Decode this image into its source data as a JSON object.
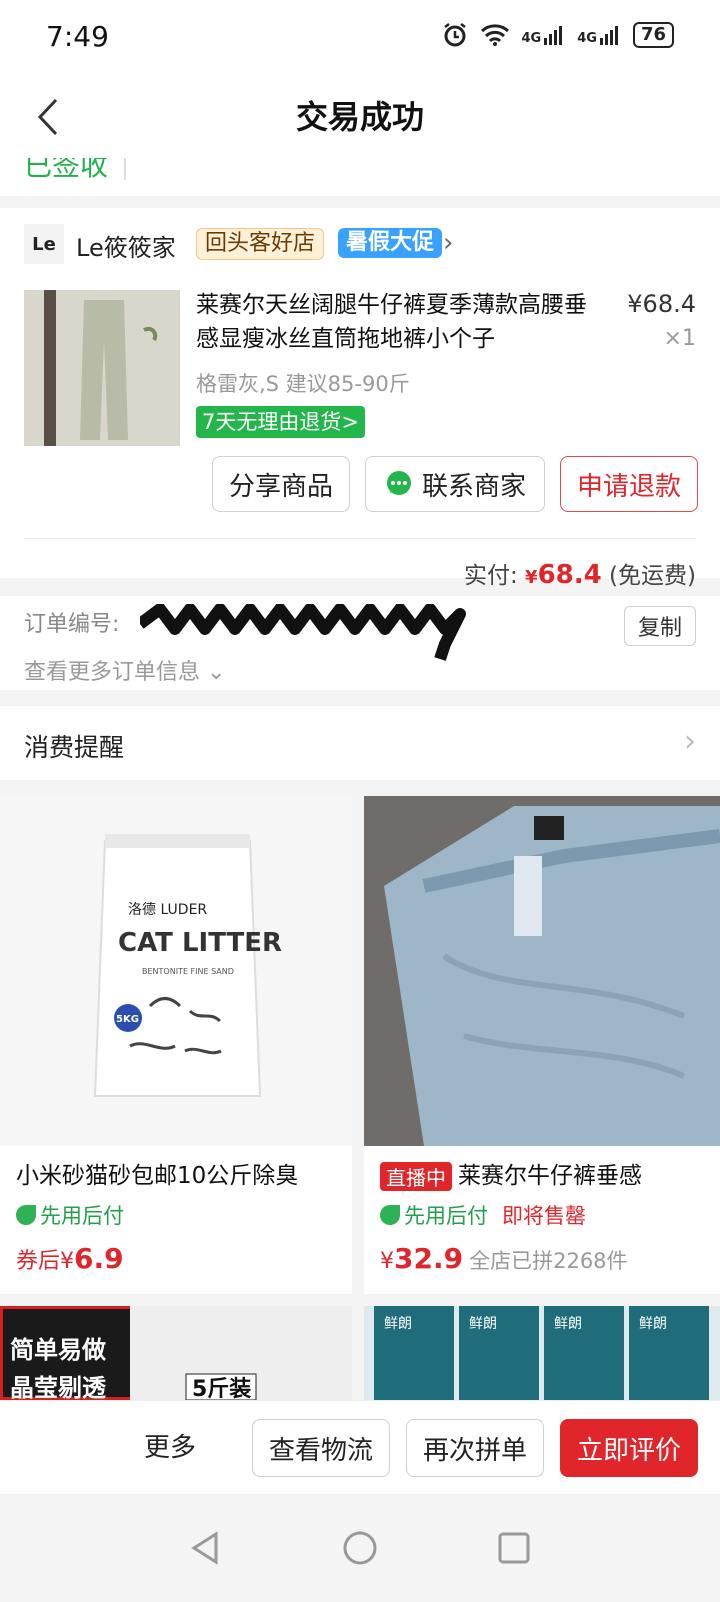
{
  "status": {
    "time": "7:49",
    "net1": "4G",
    "net2": "4G",
    "battery": "76"
  },
  "nav": {
    "title": "交易成功"
  },
  "delivery": {
    "status": "已签收"
  },
  "shop": {
    "logo": "Le",
    "name": "Le筱筱家",
    "tag_repeat": "回头客好店",
    "tag_promo": "暑假大促"
  },
  "product": {
    "title": "莱赛尔天丝阔腿牛仔裤夏季薄款高腰垂感显瘦冰丝直筒拖地裤小个子",
    "price": "¥68.4",
    "qty": "×1",
    "spec": "格雷灰,S 建议85-90斤",
    "return_tag": "7天无理由退货",
    "return_chevron": ">"
  },
  "actions": {
    "share": "分享商品",
    "contact": "联系商家",
    "refund": "申请退款"
  },
  "payment": {
    "label": "实付:",
    "currency": "¥",
    "amount": "68.4",
    "note": "(免运费)"
  },
  "order": {
    "label": "订单编号:",
    "copy": "复制",
    "more": "查看更多订单信息"
  },
  "reminder": {
    "label": "消费提醒"
  },
  "recommendations": [
    {
      "title": "小米砂猫砂包邮10公斤除臭",
      "paylater": "先用后付",
      "price_prefix": "券后",
      "currency": "¥",
      "price": "6.9",
      "bag_brand": "洛德 LUDER",
      "bag_title": "CAT LITTER",
      "bag_sub": "BENTONITE FINE SAND",
      "bag_weight": "5KG"
    },
    {
      "live": "直播中",
      "title": "莱赛尔牛仔裤垂感",
      "paylater": "先用后付",
      "soldout": "即将售罄",
      "currency": "¥",
      "price": "32.9",
      "sold": "全店已拼2268件"
    },
    {
      "overlay_line1": "简单易做",
      "overlay_line2": "晶莹剔透",
      "overlay_badge": "5斤装"
    },
    {
      "brand": "鲜朗"
    }
  ],
  "bottom": {
    "more": "更多",
    "logistics": "查看物流",
    "rebuy": "再次拼单",
    "review": "立即评价"
  },
  "colors": {
    "accent_red": "#e0262b",
    "green": "#22b64b",
    "promo_blue": "#39a1ff"
  }
}
